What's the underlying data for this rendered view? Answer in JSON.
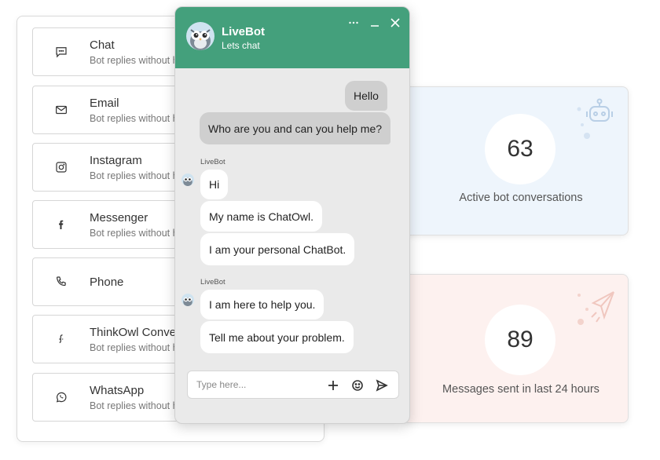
{
  "channels": [
    {
      "name": "Chat",
      "desc": "Bot replies without human intervention",
      "icon": "chat-bubble-icon"
    },
    {
      "name": "Email",
      "desc": "Bot replies without human intervention",
      "icon": "envelope-icon"
    },
    {
      "name": "Instagram",
      "desc": "Bot replies without human intervention",
      "icon": "instagram-icon"
    },
    {
      "name": "Messenger",
      "desc": "Bot replies without human intervention",
      "icon": "facebook-icon"
    },
    {
      "name": "Phone",
      "desc": "",
      "icon": "phone-icon"
    },
    {
      "name": "ThinkOwl Conversations",
      "desc": "Bot replies without human intervention",
      "icon": "thinkowl-icon"
    },
    {
      "name": "WhatsApp",
      "desc": "Bot replies without human intervention",
      "icon": "whatsapp-icon"
    }
  ],
  "chat": {
    "bot_name": "LiveBot",
    "status": "Lets chat",
    "input_placeholder": "Type here...",
    "messages": [
      {
        "from": "user",
        "text": "Hello"
      },
      {
        "from": "user",
        "text": "Who are you and can you help me?"
      },
      {
        "from": "bot",
        "sender": "LiveBot",
        "text": "Hi"
      },
      {
        "from": "bot",
        "text": "My name is ChatOwl."
      },
      {
        "from": "bot",
        "text": "I am your personal ChatBot."
      },
      {
        "from": "bot",
        "sender": "LiveBot",
        "text": "I am here to help you."
      },
      {
        "from": "bot",
        "text": "Tell me about your problem."
      }
    ]
  },
  "stats": {
    "active": {
      "value": "63",
      "label": "Active bot conversations"
    },
    "messages": {
      "value": "89",
      "label": "Messages sent in last 24 hours"
    }
  },
  "colors": {
    "header_green": "#44a07c",
    "user_bubble": "#cfcfcf",
    "stat_blue_bg": "#eef5fc",
    "stat_pink_bg": "#fdf1ef"
  }
}
